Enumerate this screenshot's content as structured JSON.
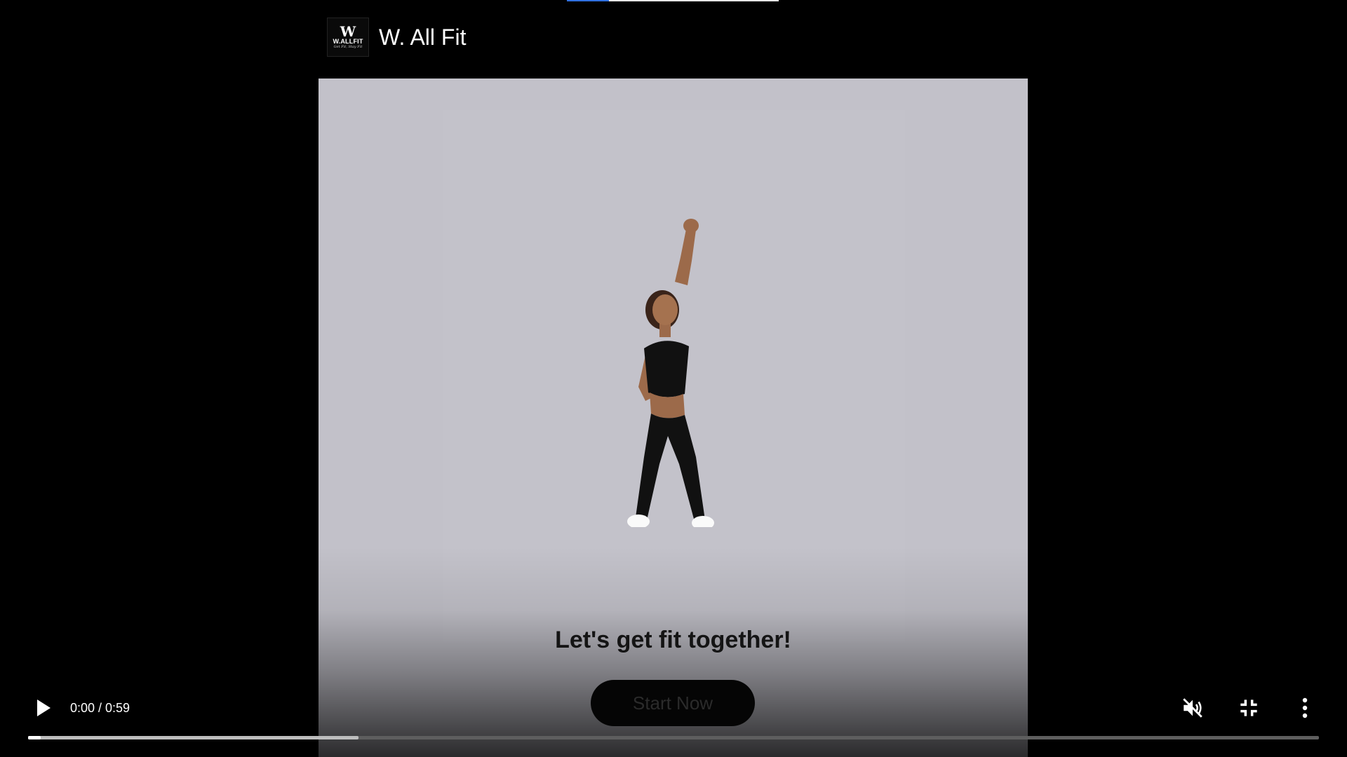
{
  "channel": {
    "name": "W. All Fit",
    "logo_mark": "W",
    "logo_text": "W.ALLFIT",
    "logo_script": "Get Fit, Stay Fit"
  },
  "video": {
    "caption": "Let's get fit together!",
    "cta_label": "Start Now",
    "background_color": "#c2c1c9"
  },
  "controls": {
    "time": "0:00 / 0:59",
    "buffered_percent": 25.6,
    "played_percent": 1,
    "play_icon": "play-icon",
    "mute_icon": "muted-volume-icon",
    "fullscreen_icon": "exit-fullscreen-icon",
    "more_icon": "more-vertical-icon"
  },
  "colors": {
    "background": "#000000",
    "progress_buffered": "#bdbdbd",
    "progress_track": "#5e5e5e",
    "top_progress_accent": "#2f6fe0"
  }
}
